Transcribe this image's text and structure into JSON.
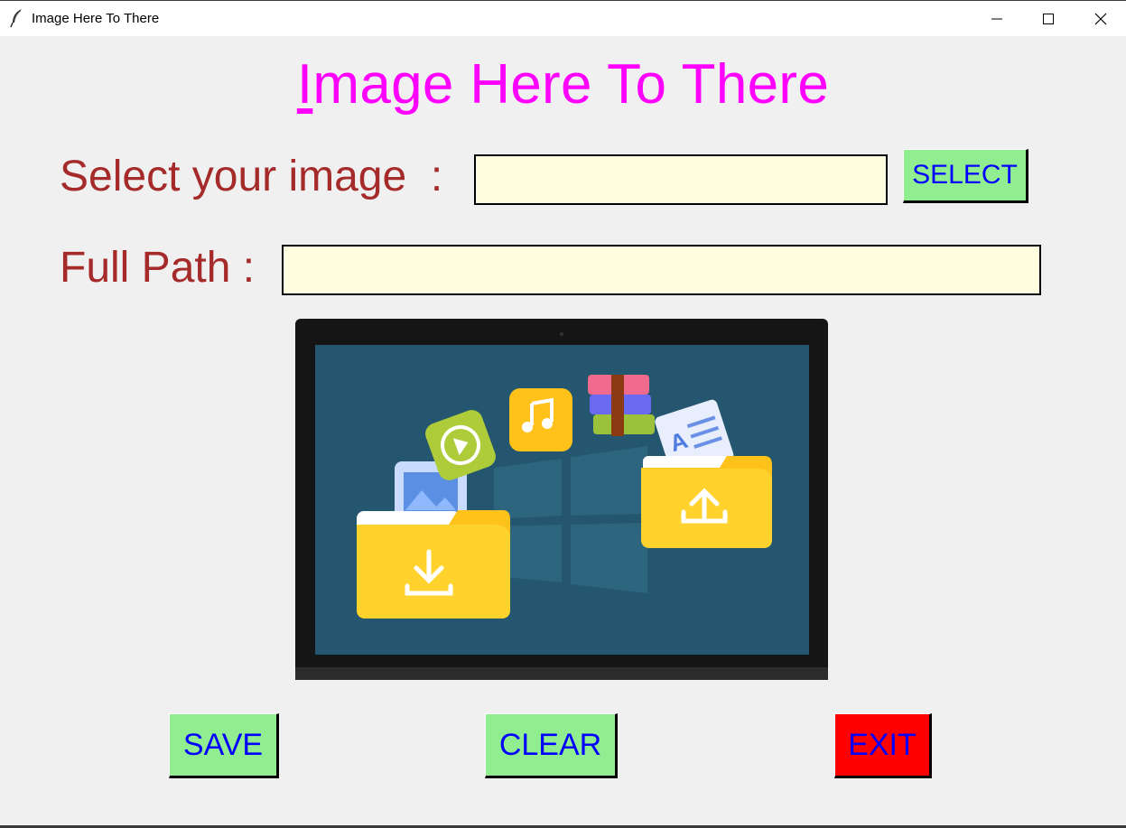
{
  "window": {
    "title": "Image Here To There"
  },
  "heading": {
    "first_letter": "I",
    "rest": "mage Here To There"
  },
  "form": {
    "select_label": "Select your image  :",
    "select_value": "",
    "select_button": "SELECT",
    "path_label": "Full Path :",
    "path_value": ""
  },
  "actions": {
    "save": "SAVE",
    "clear": "CLEAR",
    "exit": "EXIT"
  },
  "colors": {
    "heading": "#ff00ff",
    "label": "#a52a2a",
    "button_bg": "#90ee90",
    "button_text": "#0000ff",
    "exit_bg": "#ff0000",
    "field_bg": "#fffde0"
  },
  "icons": [
    "feather-icon",
    "minimize-icon",
    "maximize-icon",
    "close-icon"
  ]
}
